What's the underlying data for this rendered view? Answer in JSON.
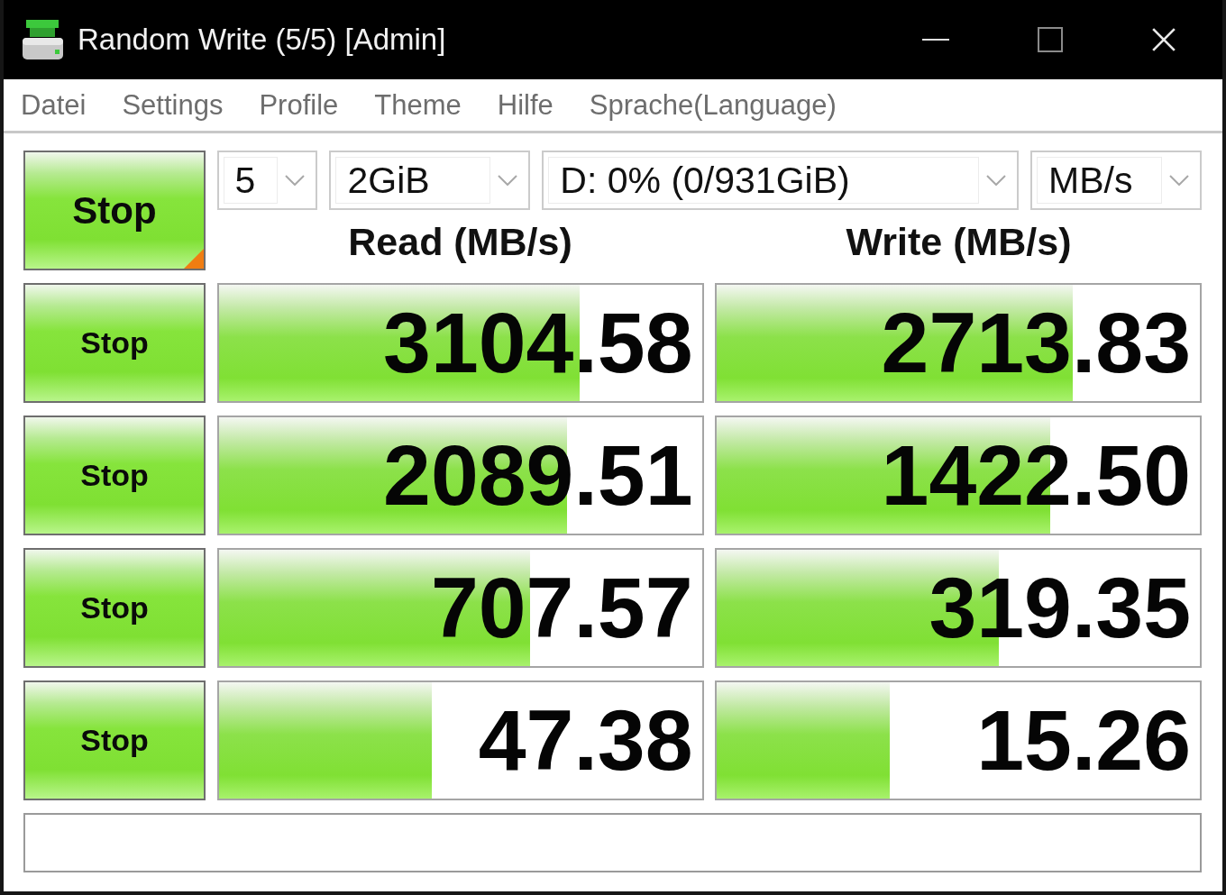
{
  "window": {
    "title": "Random Write (5/5) [Admin]"
  },
  "menu": [
    "Datei",
    "Settings",
    "Profile",
    "Theme",
    "Hilfe",
    "Sprache(Language)"
  ],
  "all_button": "Stop",
  "dropdowns": [
    "5",
    "2GiB",
    "D: 0% (0/931GiB)",
    "MB/s"
  ],
  "columns": [
    "Read (MB/s)",
    "Write (MB/s)"
  ],
  "rows": [
    {
      "button": "Stop",
      "read": {
        "value": "3104.58",
        "level": 0.748
      },
      "write": {
        "value": "2713.83",
        "level": 0.737
      }
    },
    {
      "button": "Stop",
      "read": {
        "value": "2089.51",
        "level": 0.722
      },
      "write": {
        "value": "1422.50",
        "level": 0.69
      }
    },
    {
      "button": "Stop",
      "read": {
        "value": "707.57",
        "level": 0.644
      },
      "write": {
        "value": "319.35",
        "level": 0.584
      }
    },
    {
      "button": "Stop",
      "read": {
        "value": "47.38",
        "level": 0.442
      },
      "write": {
        "value": "15.26",
        "level": 0.358
      }
    }
  ]
}
